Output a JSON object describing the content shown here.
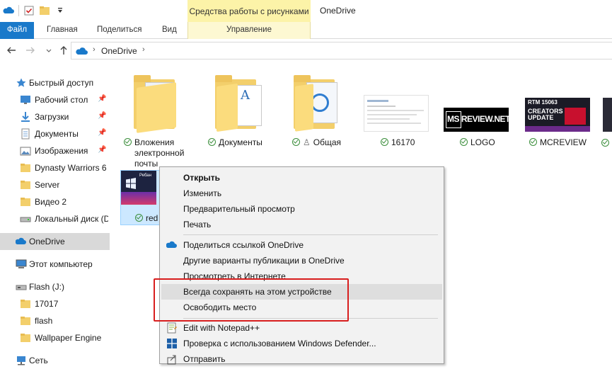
{
  "window": {
    "title": "OneDrive",
    "contextual_tab_header": "Средства работы с рисунками"
  },
  "ribbon": {
    "tabs": [
      "Файл",
      "Главная",
      "Поделиться",
      "Вид",
      "Управление"
    ]
  },
  "address": {
    "path": "OneDrive"
  },
  "nav": {
    "items": [
      {
        "label": "Быстрый доступ",
        "icon": "star-icon"
      },
      {
        "label": "Рабочий стол",
        "icon": "desktop-icon",
        "pinned": true
      },
      {
        "label": "Загрузки",
        "icon": "download-icon",
        "pinned": true
      },
      {
        "label": "Документы",
        "icon": "documents-icon",
        "pinned": true
      },
      {
        "label": "Изображения",
        "icon": "pictures-icon",
        "pinned": true
      },
      {
        "label": "Dynasty Warriors 6 -",
        "icon": "folder-icon"
      },
      {
        "label": "Server",
        "icon": "folder-icon"
      },
      {
        "label": "Видео 2",
        "icon": "folder-icon"
      },
      {
        "label": "Локальный диск (D",
        "icon": "drive-icon"
      },
      {
        "label": "OneDrive",
        "icon": "cloud-icon",
        "selected": true
      },
      {
        "label": "Этот компьютер",
        "icon": "computer-icon"
      },
      {
        "label": "Flash (J:)",
        "icon": "usb-drive-icon"
      },
      {
        "label": "17017",
        "icon": "folder-icon"
      },
      {
        "label": "flash",
        "icon": "folder-icon"
      },
      {
        "label": "Wallpaper Engine",
        "icon": "folder-icon"
      },
      {
        "label": "Сеть",
        "icon": "network-icon"
      }
    ]
  },
  "files": [
    {
      "name": "Вложения электронной почты",
      "name_lines": [
        "Вложения",
        "электронной",
        "почты"
      ],
      "type": "folder"
    },
    {
      "name": "Документы",
      "type": "folder"
    },
    {
      "name": "Общая",
      "type": "folder",
      "shared": true
    },
    {
      "name": "16170",
      "type": "image"
    },
    {
      "name": "LOGO",
      "type": "image"
    },
    {
      "name": "MCREVIEW",
      "type": "image"
    },
    {
      "name": "red",
      "type": "image",
      "selected": true
    }
  ],
  "thumb_text": {
    "logo": "MS REVIEW.NET",
    "mcreview_top": "RTM 15063",
    "mcreview_line1": "CREATORS",
    "mcreview_line2": "UPDATE",
    "red_partial": "Ребан"
  },
  "context_menu": {
    "items": [
      {
        "label": "Открыть",
        "bold": true
      },
      {
        "label": "Изменить"
      },
      {
        "label": "Предварительный просмотр"
      },
      {
        "label": "Печать"
      },
      {
        "label": "Поделиться ссылкой OneDrive",
        "icon": "cloud-icon"
      },
      {
        "label": "Другие варианты публикации в OneDrive"
      },
      {
        "label": "Просмотреть в Интернете"
      },
      {
        "label": "Всегда сохранять на этом устройстве",
        "highlighted": true
      },
      {
        "label": "Освободить место"
      },
      {
        "label": "Edit with Notepad++",
        "icon": "notepad-plus-icon"
      },
      {
        "label": "Проверка с использованием Windows Defender...",
        "icon": "defender-icon"
      },
      {
        "label": "Отправить",
        "icon": "share-icon"
      }
    ]
  },
  "colors": {
    "accent": "#1979ca",
    "contextual_tab": "#fcf3a8",
    "highlight_box": "#d81e1e",
    "folder": "#f3cf6b",
    "sync_ok": "#3b8e3b"
  }
}
